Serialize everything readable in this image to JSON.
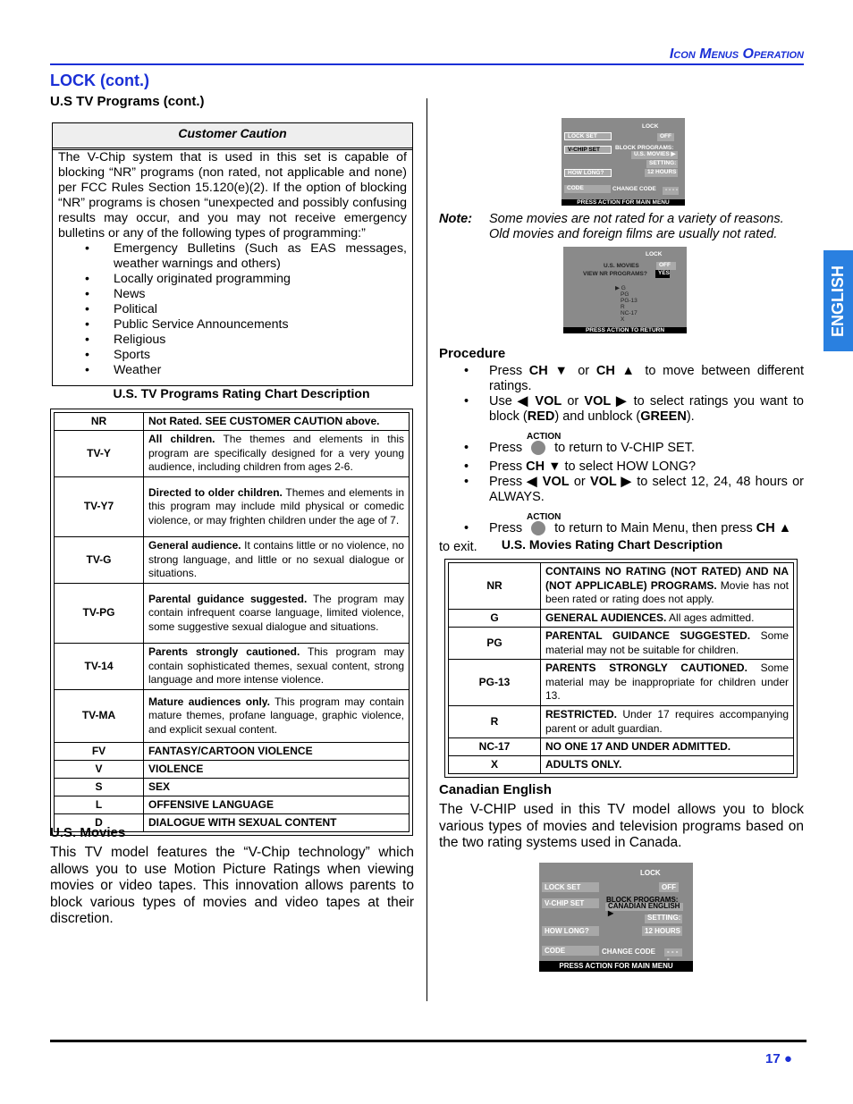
{
  "header": "Icon Menus Operation",
  "section_title": "LOCK (cont.)",
  "subtitle": "U.S TV Programs (cont.)",
  "caution": {
    "title": "Customer Caution",
    "text": "The V-Chip system that is used in this set is capable of blocking “NR” programs (non rated, not applicable and none) per FCC Rules Section 15.120(e)(2). If the option of blocking “NR” programs is chosen “unexpected and possibly confusing results may occur, and you may not receive emergency bulletins or any of the following types of programming:”",
    "items": [
      "Emergency Bulletins (Such as EAS messages, weather warnings and others)",
      "Locally originated programming",
      "News",
      "Political",
      "Public Service Announcements",
      "Religious",
      "Sports",
      "Weather"
    ]
  },
  "tv_table": {
    "title": "U.S. TV Programs Rating Chart Description",
    "rows": [
      [
        "NR",
        "Not Rated. SEE CUSTOMER CAUTION above.",
        ""
      ],
      [
        "TV-Y",
        "All children.",
        "The themes and elements in this program are specifically designed for a very young audience, including children from ages 2-6."
      ],
      [
        "TV-Y7",
        "Directed to older children.",
        "Themes and elements in this program may include mild physical or comedic violence, or may frighten children under the age of 7."
      ],
      [
        "TV-G",
        "General audience.",
        "It contains little or no violence, no strong language, and little or no sexual dialogue or situations."
      ],
      [
        "TV-PG",
        "Parental guidance suggested.",
        "The program may contain infrequent coarse language, limited violence, some suggestive sexual dialogue and situations."
      ],
      [
        "TV-14",
        "Parents strongly cautioned.",
        "This program may contain sophisticated themes, sexual content, strong language and more intense violence."
      ],
      [
        "TV-MA",
        "Mature audiences only.",
        "This program may contain mature themes, profane language, graphic violence, and explicit sexual content."
      ],
      [
        "FV",
        "FANTASY/CARTOON VIOLENCE",
        ""
      ],
      [
        "V",
        "VIOLENCE",
        ""
      ],
      [
        "S",
        "SEX",
        ""
      ],
      [
        "L",
        "OFFENSIVE LANGUAGE",
        ""
      ],
      [
        "D",
        "DIALOGUE WITH SEXUAL CONTENT",
        ""
      ]
    ]
  },
  "us_movies": {
    "heading": "U.S. Movies",
    "text": "This TV model features the “V-Chip technology” which allows you to use Motion Picture Ratings when viewing movies or video tapes. This innovation allows parents to block various types of movies and video tapes at their discretion."
  },
  "menu1": {
    "title": "LOCK",
    "lock_set": "LOCK SET",
    "off": "OFF",
    "vchip": "V-CHIP SET",
    "block": "BLOCK PROGRAMS:",
    "block_val": "U.S.   MOVIES ▶",
    "setting": "SETTING:",
    "how_long": "HOW LONG?",
    "hours": "12 HOURS",
    "code": "CODE",
    "change_code": "CHANGE CODE",
    "dashes": "- - - -",
    "footer": "PRESS ACTION FOR MAIN MENU"
  },
  "note": {
    "label": "Note:",
    "text": "Some movies are not rated for a variety of reasons. Old movies and foreign films are usually not rated."
  },
  "menu2": {
    "title": "LOCK",
    "us_movies": "U.S. MOVIES",
    "off": "OFF ▶",
    "view_nr": "VIEW NR PROGRAMS?",
    "yes": "YES",
    "ratings": [
      "▶ G",
      "PG",
      "PG-13",
      "R",
      "NC-17",
      "X"
    ],
    "footer": "PRESS ACTION TO RETURN"
  },
  "procedure": {
    "heading": "Procedure",
    "action_label": "ACTION",
    "s1": [
      "Press ",
      "CH ▼",
      " or ",
      "CH ▲",
      " to move between different ratings."
    ],
    "s2": [
      "Use ",
      "◀ VOL",
      " or ",
      "VOL ▶",
      " to select ratings you want to block (",
      "RED",
      ") and unblock (",
      "GREEN",
      "). "
    ],
    "s3": [
      "Press",
      "to return to V-CHIP SET."
    ],
    "s4": [
      "Press ",
      "CH ▼",
      " to select HOW LONG?"
    ],
    "s5": [
      "Press ",
      "◀ VOL",
      " or ",
      "VOL ▶",
      " to select 12, 24, 48 hours or ALWAYS."
    ],
    "s6": [
      "Press",
      "to return to Main Menu, then press ",
      "CH ▲",
      "to exit."
    ]
  },
  "movies_table": {
    "title": "U.S. Movies Rating Chart Description",
    "rows": [
      [
        "NR",
        "CONTAINS NO RATING (NOT RATED) AND NA (NOT APPLICABLE) PROGRAMS.",
        "Movie has not been rated or rating does not apply."
      ],
      [
        "G",
        "GENERAL AUDIENCES.",
        "All ages admitted."
      ],
      [
        "PG",
        "PARENTAL GUIDANCE SUGGESTED.",
        "Some material may not be suitable for children."
      ],
      [
        "PG-13",
        "PARENTS STRONGLY CAUTIONED.",
        "Some material may be inappropriate for children under 13."
      ],
      [
        "R",
        "RESTRICTED.",
        "Under 17 requires accompanying parent or adult guardian."
      ],
      [
        "NC-17",
        "NO ONE 17 AND UNDER ADMITTED.",
        ""
      ],
      [
        "X",
        "ADULTS ONLY.",
        ""
      ]
    ]
  },
  "canadian": {
    "heading": "Canadian English",
    "text": "The V-CHIP used in this TV model allows you to block various types of movies and television programs based on the two rating systems used in Canada."
  },
  "menu3": {
    "title": "LOCK",
    "lock_set": "LOCK SET",
    "off": "OFF",
    "vchip": "V-CHIP SET",
    "block": "BLOCK PROGRAMS:",
    "block_val": "CANADIAN ENGLISH ▶",
    "setting": "SETTING:",
    "how_long": "HOW LONG?",
    "hours": "12 HOURS",
    "code": "CODE",
    "change_code": "CHANGE CODE",
    "dashes": "- - - -",
    "footer": "PRESS ACTION FOR MAIN MENU"
  },
  "side_tab": "ENGLISH",
  "page_number": "17 ●"
}
